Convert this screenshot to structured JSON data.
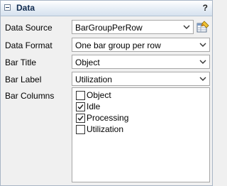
{
  "panel": {
    "title": "Data",
    "help": "?"
  },
  "fields": {
    "data_source": {
      "label": "Data Source",
      "value": "BarGroupPerRow"
    },
    "data_format": {
      "label": "Data Format",
      "value": "One bar group per row"
    },
    "bar_title": {
      "label": "Bar Title",
      "value": "Object"
    },
    "bar_label": {
      "label": "Bar Label",
      "value": "Utilization"
    },
    "bar_columns": {
      "label": "Bar Columns",
      "items": [
        {
          "label": "Object",
          "checked": false
        },
        {
          "label": "Idle",
          "checked": true
        },
        {
          "label": "Processing",
          "checked": true
        },
        {
          "label": "Utilization",
          "checked": false
        }
      ]
    }
  },
  "icons": {
    "collapse": "minus-box-icon",
    "dropdown": "chevron-down-icon",
    "pick": "edit-table-icon",
    "check": "checkmark-icon"
  }
}
